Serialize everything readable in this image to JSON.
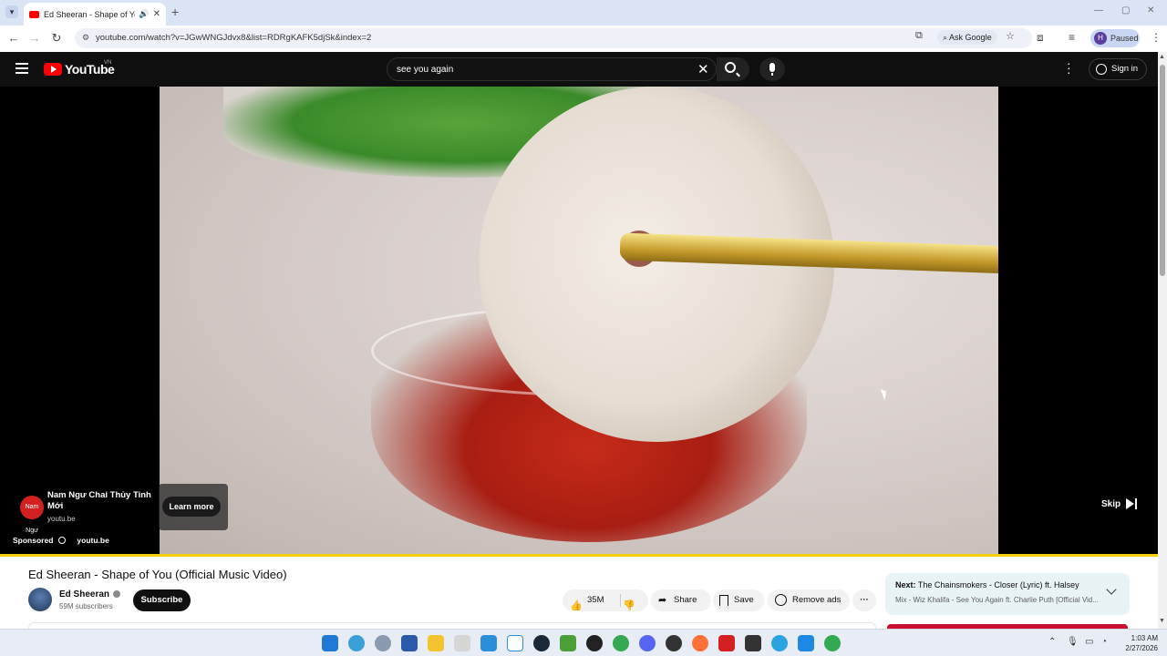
{
  "browser": {
    "tab_title": "Ed Sheeran - Shape of You",
    "tab_audio_icon": "speaker-icon",
    "url": "youtube.com/watch?v=JGwWNGJdvx8&list=RDRgKAFK5djSk&index=2",
    "ask_google": "Ask Google",
    "profile_initial": "H",
    "profile_status": "Paused"
  },
  "youtube": {
    "logo_text": "YouTube",
    "country_code": "VN",
    "search_query": "see you again",
    "sign_in": "Sign in"
  },
  "ad": {
    "advertiser": "Nam Ngư Chai Thủy Tinh Mới",
    "domain": "youtu.be",
    "learn_more": "Learn more",
    "sponsored": "Sponsored",
    "sponsored_domain": "youtu.be",
    "skip": "Skip",
    "logo_text": "Nam Ngư"
  },
  "video": {
    "title": "Ed Sheeran - Shape of You (Official Music Video)",
    "channel": "Ed Sheeran",
    "subscribers": "59M subscribers",
    "subscribe": "Subscribe",
    "likes": "35M",
    "share": "Share",
    "save": "Save",
    "remove_ads": "Remove ads",
    "more": "···"
  },
  "up_next": {
    "label": "Next:",
    "title": "The Chainsmokers - Closer (Lyric) ft. Halsey",
    "mix": "Mix - Wiz Khalifa - See You Again ft. Charlie Puth [Official Vid..."
  },
  "taskbar": {
    "time": "1:03 AM",
    "date": "2/27/2026"
  },
  "colors": {
    "yt_red": "#ff0000",
    "progress": "#f6d100",
    "header_bg": "#0f0f0f"
  }
}
